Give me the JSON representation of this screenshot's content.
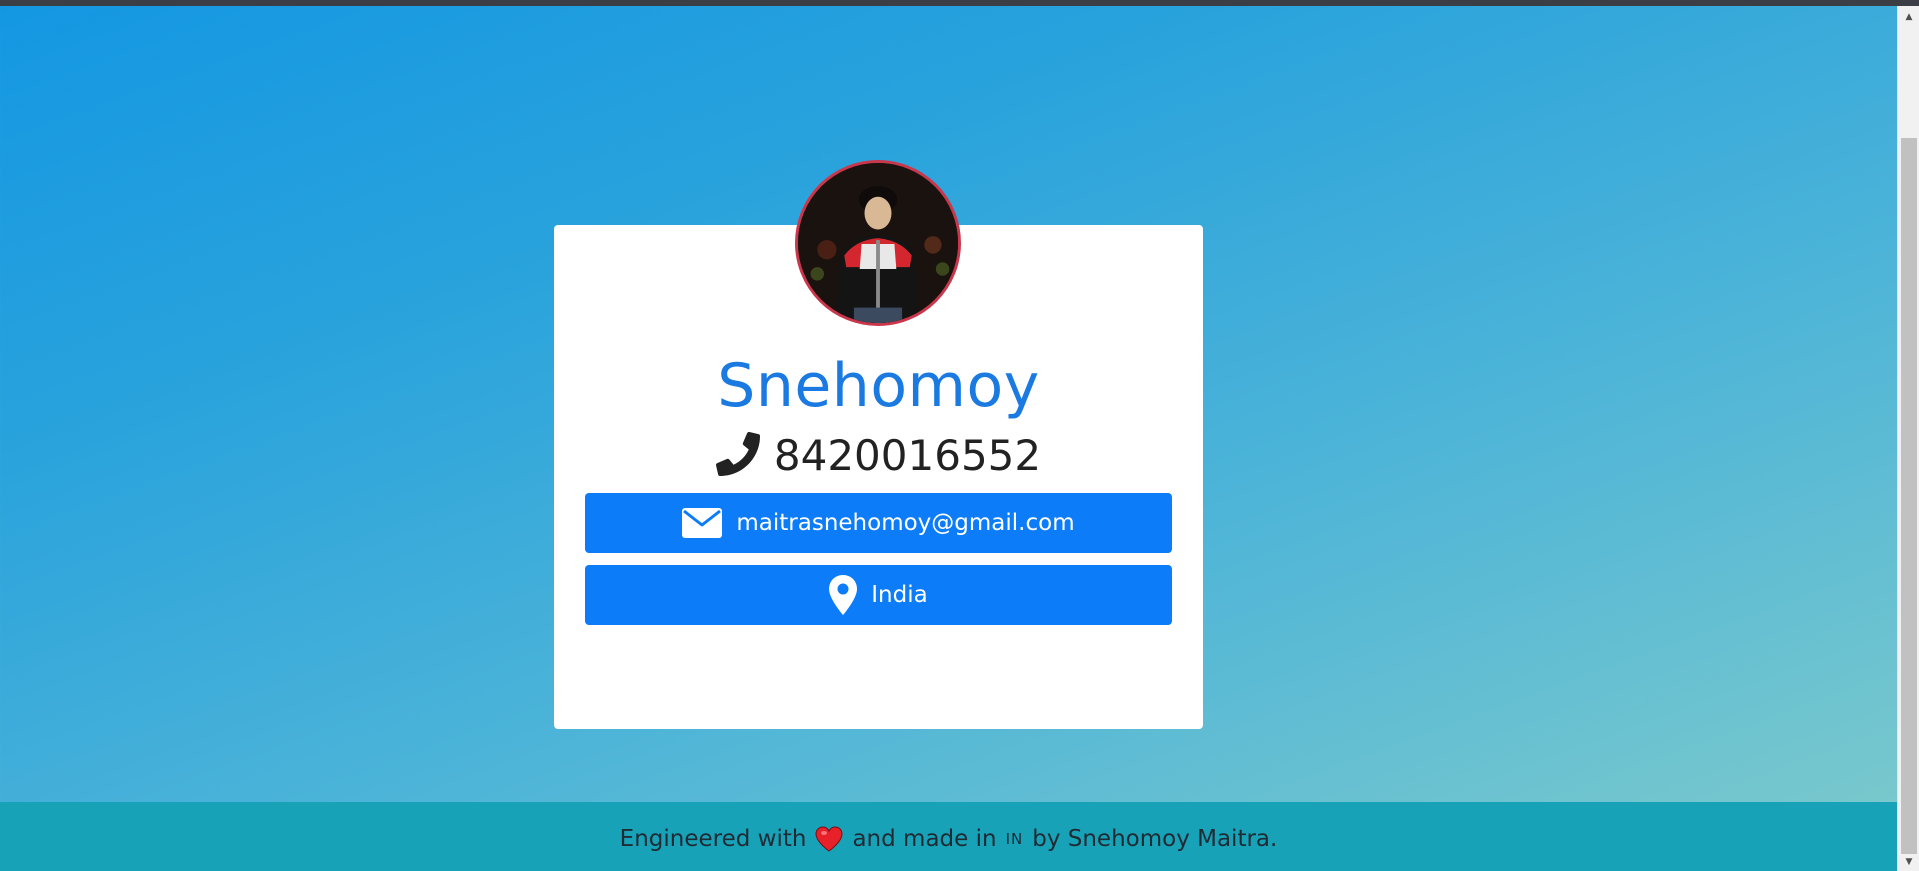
{
  "profile": {
    "name": "Snehomoy",
    "phone": "8420016552",
    "email": "maitrasnehomoy@gmail.com",
    "location": "India"
  },
  "footer": {
    "part1": "Engineered with",
    "part2": "and made in",
    "country_code": "IN",
    "part3": "by Snehomoy Maitra."
  },
  "icons": {
    "phone": "phone-icon",
    "email": "envelope-icon",
    "location": "map-pin-icon",
    "heart": "heart-icon"
  },
  "colors": {
    "accent": "#0d7cf8",
    "name": "#1a7ae2",
    "footer_bg": "#17a2b8",
    "avatar_border": "#c8374c",
    "heart": "#e8202a"
  }
}
